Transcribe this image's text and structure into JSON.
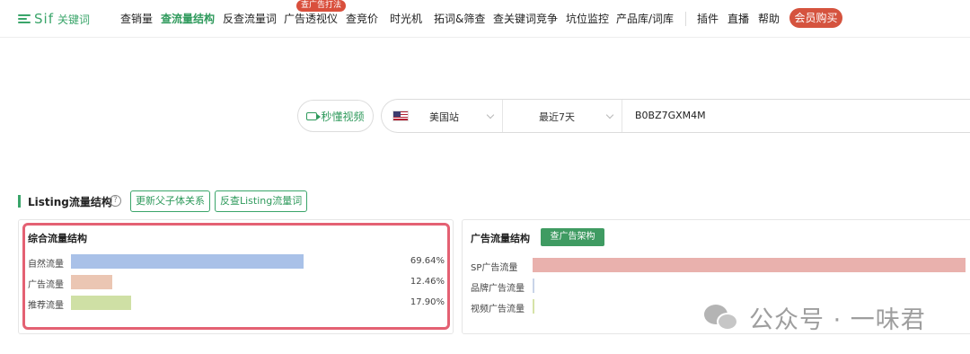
{
  "app": {
    "logo": "Sif",
    "logo_sub": "关键词"
  },
  "nav": {
    "items": [
      "查销量",
      "查流量结构",
      "反查流量词",
      "广告透视仪",
      "查竞价",
      "时光机",
      "拓词&筛查",
      "查关键词竞争",
      "坑位监控",
      "产品库/词库",
      "插件",
      "直播",
      "帮助"
    ],
    "active_index": 1,
    "badge": "查广告打法",
    "vip": "会员购买"
  },
  "search": {
    "video_btn": "秒懂视频",
    "site": "美国站",
    "date_range": "最近7天",
    "asin": "B0BZ7GXM4M"
  },
  "section": {
    "title": "Listing流量结构",
    "btn_update": "更新父子体关系",
    "btn_reverse": "反查Listing流量词"
  },
  "left_panel": {
    "title": "综合流量结构",
    "rows": [
      {
        "label": "自然流量",
        "pct": "69.64%",
        "value": 69.64,
        "color": "#a9c1e8"
      },
      {
        "label": "广告流量",
        "pct": "12.46%",
        "value": 12.46,
        "color": "#ebc6b3"
      },
      {
        "label": "推荐流量",
        "pct": "17.90%",
        "value": 17.9,
        "color": "#cfe0a5"
      }
    ]
  },
  "right_panel": {
    "title": "广告流量结构",
    "btn": "查广告架构",
    "rows": [
      {
        "label": "SP广告流量",
        "value": 100,
        "color": "#e9b1ad"
      },
      {
        "label": "品牌广告流量",
        "value": 0,
        "color": "#c9d4e8"
      },
      {
        "label": "视频广告流量",
        "value": 0,
        "color": "#d6e3a8"
      }
    ]
  },
  "watermark": {
    "text": "公众号 · 一味君",
    "icon": "wechat-icon"
  }
}
